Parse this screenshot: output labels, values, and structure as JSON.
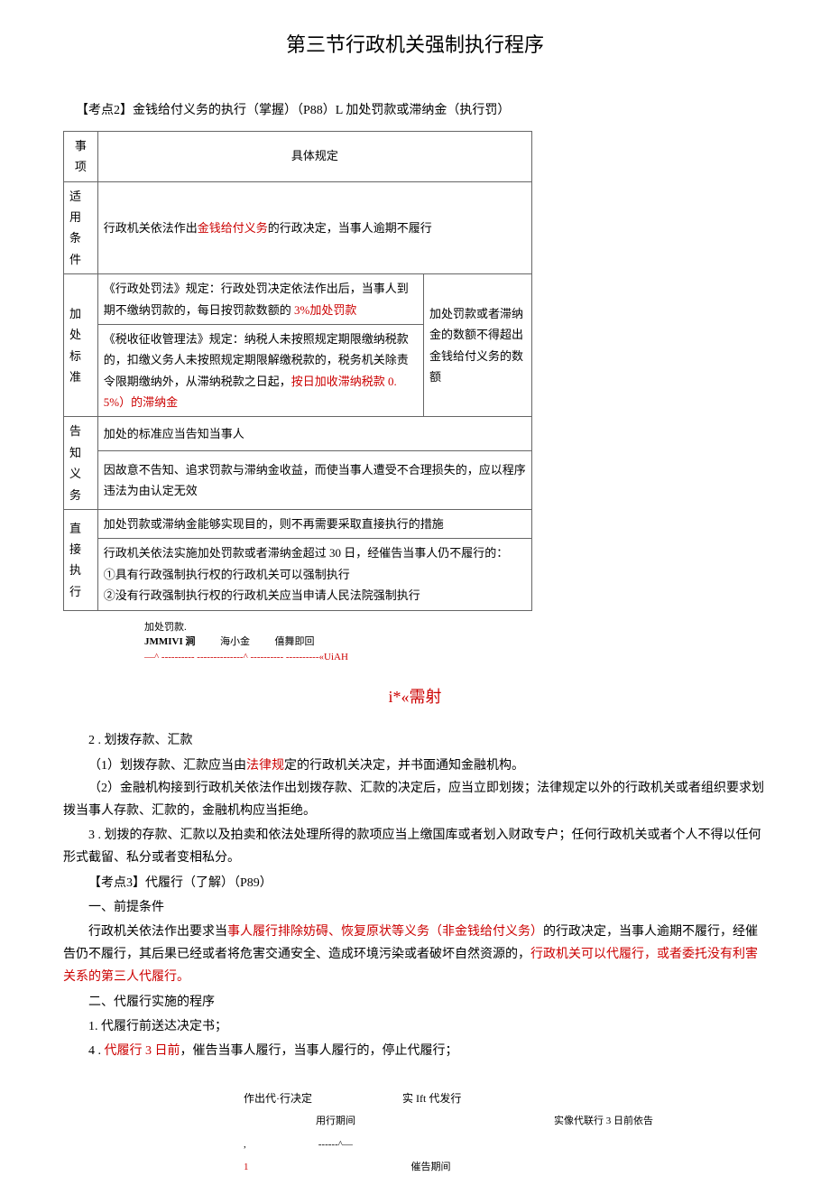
{
  "title": "第三节行政机关强制执行程序",
  "kaodian2": {
    "prefix": "【考点2】金钱给付义务的执行（掌握）（P88）L 加处罚款或滞纳金（执行罚）",
    "header_col1": "事项",
    "header_col2": "具体规定",
    "row1_col1": "适用条件",
    "row1_col2_a": "行政机关依法作出",
    "row1_col2_b": "金钱给付义务",
    "row1_col2_c": "的行政决定，当事人逾期不履行",
    "row2_col1": "加处标准",
    "row2_cell1_a": "《行政处罚法》规定：行政处罚决定依法作出后，当事人到期不缴纳罚款的，每日按罚款数额的 ",
    "row2_cell1_b": "3%加处罚款",
    "row2_cell2_a": "《税收征收管理法》规定：纳税人未按照规定期限缴纳税款的，扣缴义务人未按照规定期限解缴税款的，税务机关除责令限期缴纳外，从滞纳税款之日起，",
    "row2_cell2_b": "按日加收滞纳税款 0. 5%）的滞纳金",
    "row2_right": "加处罚款或者滞纳金的数额不得超出金钱给付义务的数额",
    "row3_col1": "告知义务",
    "row3_line1": "加处的标准应当告知当事人",
    "row3_line2": "因故意不告知、追求罚款与滞纳金收益，而使当事人遭受不合理损失的，应以程序违法为由认定无效",
    "row4_col1": "直接执行",
    "row4_line1": "加处罚款或滞纳金能够实现目的，则不再需要采取直接执行的措施",
    "row4_line2": "行政机关依法实施加处罚款或者滞纳金超过 30 日，经催告当事人仍不履行的：",
    "row4_line3": "①具有行政强制执行权的行政机关可以强制执行",
    "row4_line4": "②没有行政强制执行权的行政机关应当申请人民法院强制执行"
  },
  "midtext": {
    "line1_a": "加处罚款.",
    "line1_b": "JMMIVI 涧",
    "line1_c": "海小金",
    "line1_d": "僖舞即回",
    "line2": "—^ ---------- --------------^ ---------- ----------«UiAH"
  },
  "center_label": "i*«需射",
  "section2": {
    "p1": "2 . 划拨存款、汇款",
    "p2_a": "（1）划拨存款、汇款应当由",
    "p2_b": "法律规",
    "p2_c": "定的行政机关决定，并书面通知金融机构。",
    "p3": "（2）金融机构接到行政机关依法作出划拨存款、汇款的决定后，应当立即划拨；法律规定以外的行政机关或者组织要求划拨当事人存款、汇款的，金融机构应当拒绝。",
    "p4": "3 . 划拨的存款、汇款以及拍卖和依法处理所得的款项应当上缴国库或者划入财政专户；任何行政机关或者个人不得以任何形式截留、私分或者变相私分。"
  },
  "kaodian3": {
    "title": "【考点3】代履行（了解）（P89）",
    "sub1": "一、前提条件",
    "p1_a": "行政机关依法作出要求当",
    "p1_b": "事人履行排除妨碍、恢复原状等义务（非金钱给付义务）",
    "p1_c": "的行政决定，当事人逾期不履行，经催告仍不履行，其后果已经或者将危害交通安全、造成环境污染或者破坏自然资源的，",
    "p1_d": "行政机关可以代履行，或者委托没有利害关系的第三人代履行。",
    "sub2": "二、代履行实施的程序",
    "step1": "1. 代履行前送达决定书；",
    "step2_a": "4 . ",
    "step2_b": "代履行 3 日前",
    "step2_c": "，催告当事人履行，当事人履行的，停止代履行；"
  },
  "bottom": {
    "t1": "作出代·行决定",
    "t2": "实 Ift 代发行",
    "t3": "用行期间",
    "t4": "实像代联行 3 日前依告",
    "t5": "------^—",
    "t6": "催告期间",
    "t7": ",",
    "t8": "1"
  }
}
